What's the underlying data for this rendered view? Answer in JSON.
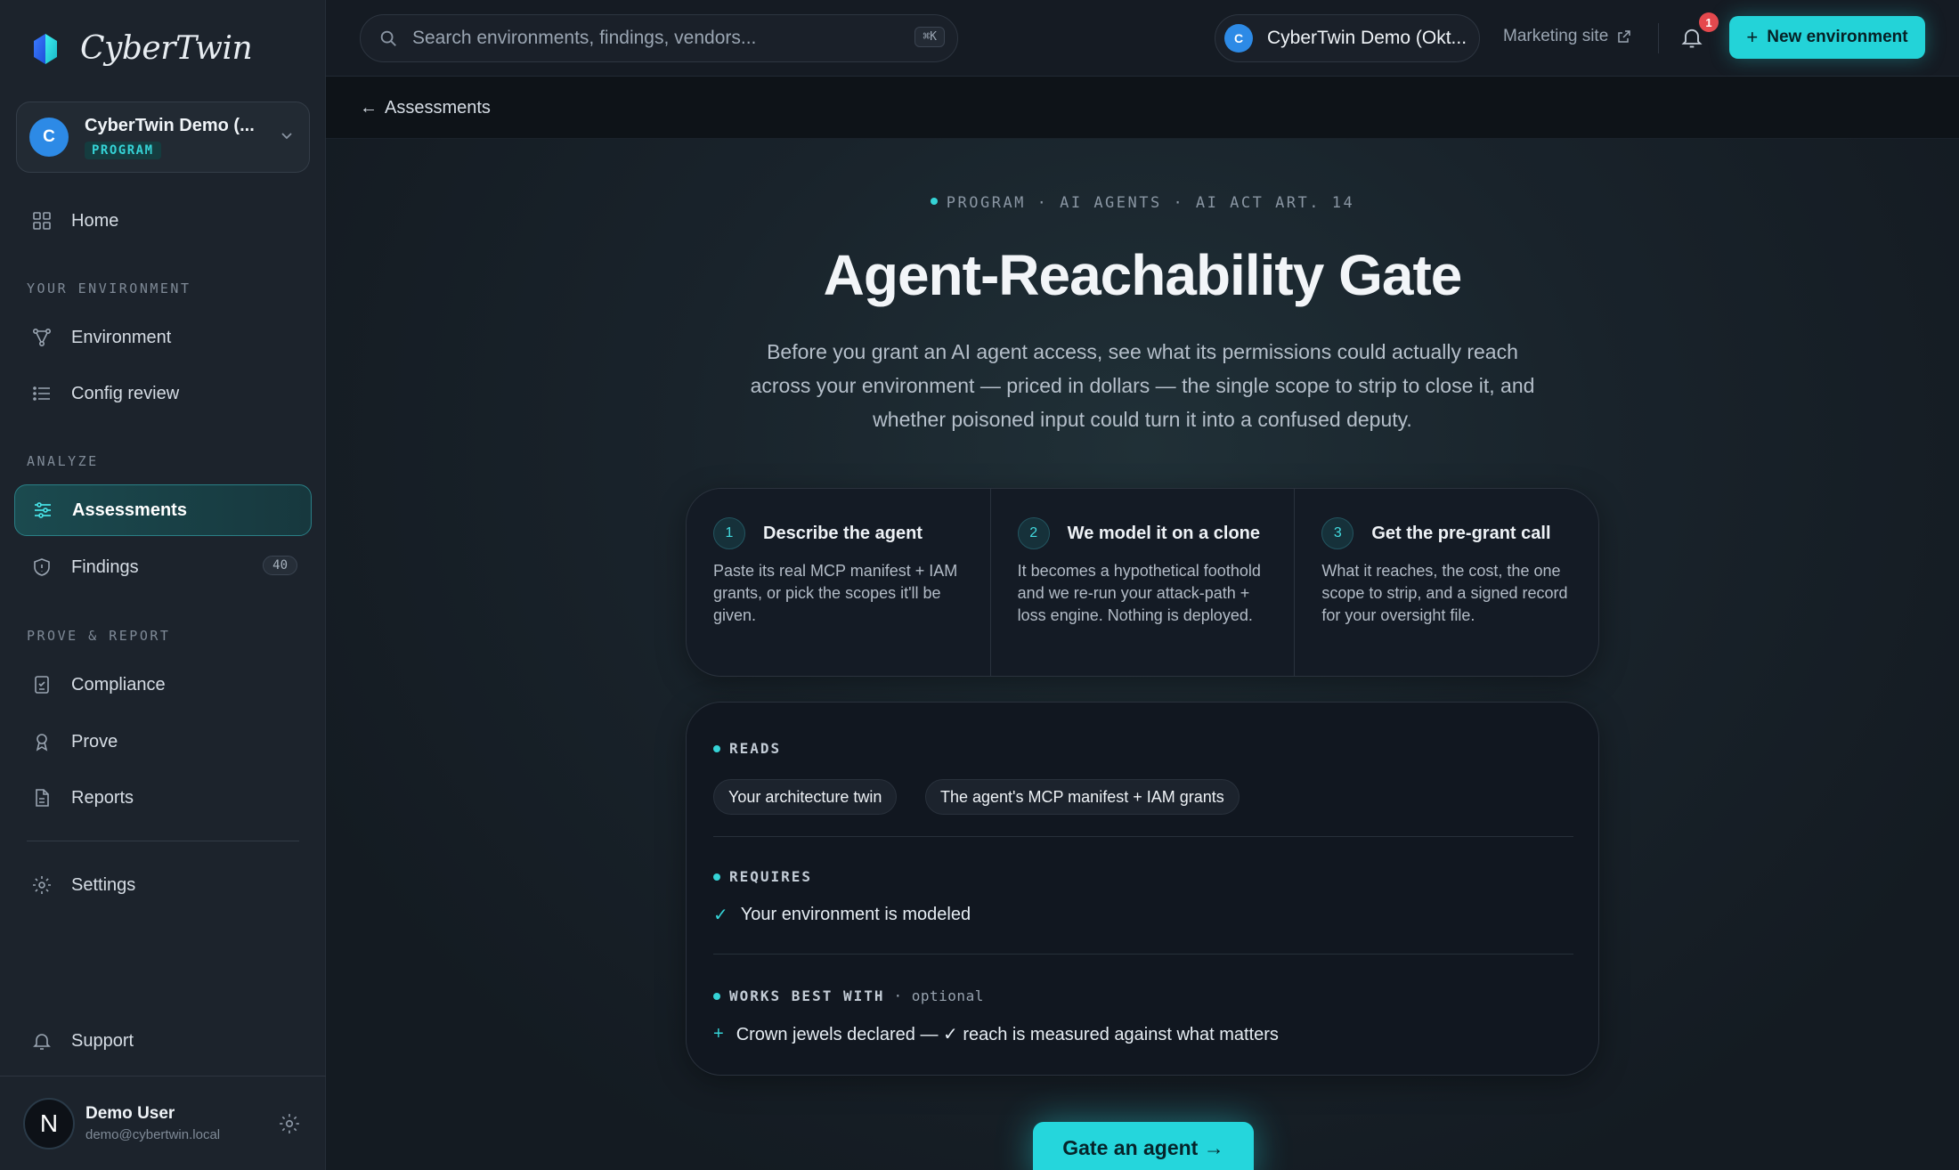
{
  "app": {
    "name": "CyberTwin"
  },
  "org": {
    "name": "CyberTwin Demo (...",
    "initial": "C",
    "tag": "PROGRAM"
  },
  "nav": {
    "home": "Home",
    "section_env": "YOUR ENVIRONMENT",
    "environment": "Environment",
    "config_review": "Config review",
    "section_analyze": "ANALYZE",
    "assessments": "Assessments",
    "findings": "Findings",
    "findings_count": "40",
    "section_prove": "PROVE & REPORT",
    "compliance": "Compliance",
    "prove": "Prove",
    "reports": "Reports",
    "settings": "Settings",
    "support": "Support"
  },
  "user": {
    "initial": "N",
    "name": "Demo User",
    "email": "demo@cybertwin.local"
  },
  "topbar": {
    "search_placeholder": "Search environments, findings, vendors...",
    "search_shortcut": "⌘K",
    "env_initial": "C",
    "env_name": "CyberTwin Demo (Okt...",
    "marketing_link": "Marketing site",
    "notification_count": "1",
    "new_env_label": "New environment"
  },
  "breadcrumb": {
    "back_label": "Assessments"
  },
  "hero": {
    "eyebrow": "PROGRAM · AI AGENTS · AI ACT ART. 14",
    "title": "Agent-Reachability Gate",
    "subtitle": "Before you grant an AI agent access, see what its permissions could actually reach across your environment — priced in dollars — the single scope to strip to close it, and whether poisoned input could turn it into a confused deputy."
  },
  "steps": [
    {
      "num": "1",
      "title": "Describe the agent",
      "desc": "Paste its real MCP manifest + IAM grants, or pick the scopes it'll be given."
    },
    {
      "num": "2",
      "title": "We model it on a clone",
      "desc": "It becomes a hypothetical foothold and we re-run your attack-path + loss engine. Nothing is deployed."
    },
    {
      "num": "3",
      "title": "Get the pre-grant call",
      "desc": "What it reaches, the cost, the one scope to strip, and a signed record for your oversight file."
    }
  ],
  "info": {
    "reads_label": "READS",
    "reads_chips": [
      "Your architecture twin",
      "The agent's MCP manifest + IAM grants"
    ],
    "requires_label": "REQUIRES",
    "requires_item": "Your environment is modeled",
    "works_label": "WORKS BEST WITH",
    "works_optional": "· optional",
    "works_item": "Crown jewels declared — ✓ reach is measured against what matters"
  },
  "cta": {
    "label": "Gate an agent →"
  },
  "colors": {
    "accent": "#23d3d8",
    "badge": "#e5484d",
    "org_avatar": "#2d8ae6"
  }
}
